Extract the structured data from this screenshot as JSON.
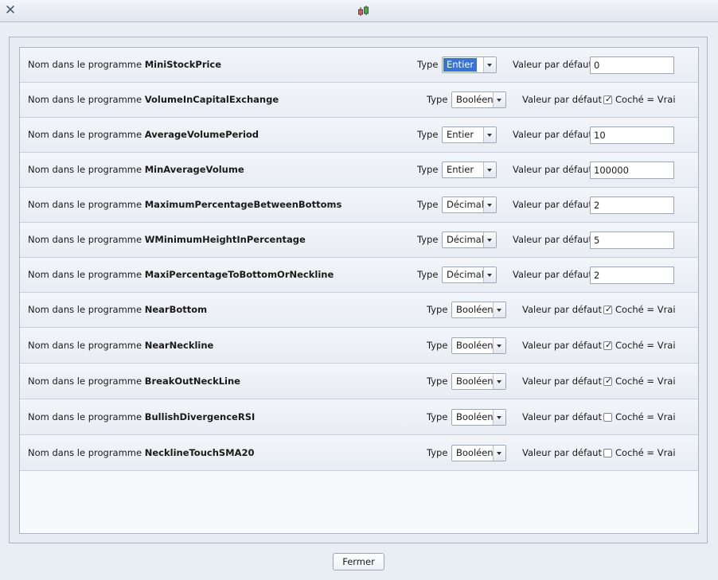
{
  "window": {
    "close_icon": "close-x-icon",
    "app_icon": "candlestick-chart-icon",
    "app_icon_colors": {
      "bearish": "#e05a5a",
      "bullish": "#3fb33f"
    }
  },
  "labels": {
    "name_prefix": "Nom dans le programme",
    "type": "Type",
    "default": "Valeur par défaut",
    "check_label": "Coché = Vrai"
  },
  "rows": [
    {
      "name": "MiniStockPrice",
      "type": "Entier",
      "value": "0",
      "selected": true
    },
    {
      "name": "VolumeInCapitalExchange",
      "type": "Booléen",
      "checked": true
    },
    {
      "name": "AverageVolumePeriod",
      "type": "Entier",
      "value": "10"
    },
    {
      "name": "MinAverageVolume",
      "type": "Entier",
      "value": "100000"
    },
    {
      "name": "MaximumPercentageBetweenBottoms",
      "type": "Décimal",
      "value": "2"
    },
    {
      "name": "WMinimumHeightInPercentage",
      "type": "Décimal",
      "value": "5"
    },
    {
      "name": "MaxiPercentageToBottomOrNeckline",
      "type": "Décimal",
      "value": "2"
    },
    {
      "name": "NearBottom",
      "type": "Booléen",
      "checked": true
    },
    {
      "name": "NearNeckline",
      "type": "Booléen",
      "checked": true
    },
    {
      "name": "BreakOutNeckLine",
      "type": "Booléen",
      "checked": true
    },
    {
      "name": "BullishDivergenceRSI",
      "type": "Booléen",
      "checked": false
    },
    {
      "name": "NecklineTouchSMA20",
      "type": "Booléen",
      "checked": false
    }
  ],
  "footer": {
    "close_label": "Fermer"
  },
  "colors": {
    "selection": "#3874d8"
  }
}
